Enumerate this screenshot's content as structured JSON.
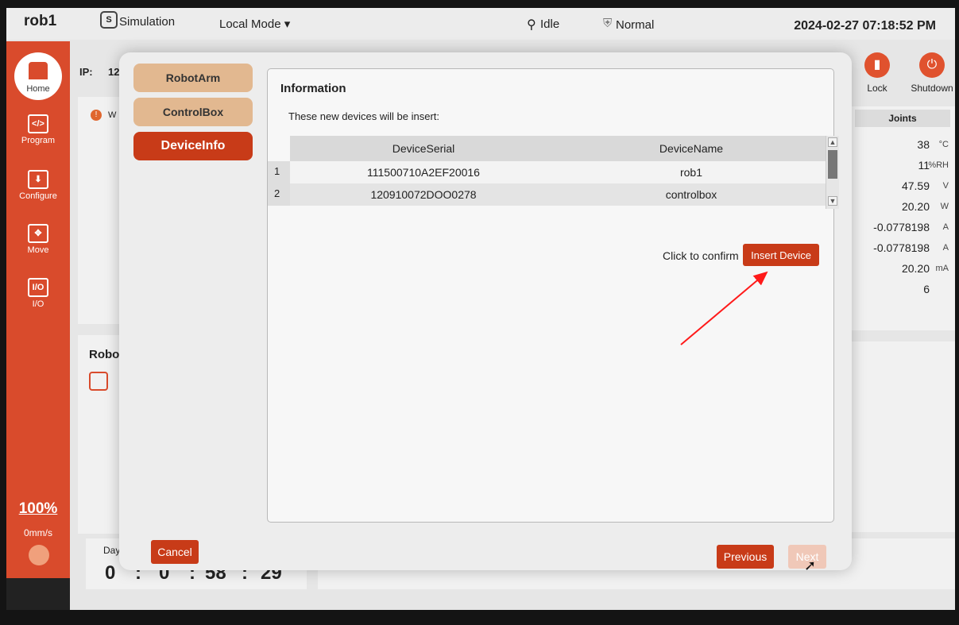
{
  "topbar": {
    "app_name": "rob1",
    "simulation_label": "Simulation",
    "sim_icon_glyph": "S",
    "mode_label": "Local Mode ▾",
    "status_label": "Idle",
    "safety_label": "Normal",
    "datetime": "2024-02-27 07:18:52 PM"
  },
  "sidebar": {
    "items": [
      {
        "label": "Home",
        "icon": "home-icon"
      },
      {
        "label": "Program",
        "icon": "code-icon",
        "glyph": "</>"
      },
      {
        "label": "Configure",
        "icon": "configure-icon",
        "glyph": "⬇"
      },
      {
        "label": "Move",
        "icon": "move-icon",
        "glyph": "✥"
      },
      {
        "label": "I/O",
        "icon": "io-icon",
        "glyph": "I/O"
      }
    ],
    "speed_percent": "100%",
    "speed_value": "0mm/s"
  },
  "background": {
    "ip_label": "IP:",
    "ip_partial": "12",
    "warning_partial": "W",
    "robot_partial": "Robo",
    "day_label": "Day",
    "timer": [
      "0",
      ":",
      "0",
      ":",
      "58",
      ":",
      "29"
    ],
    "lock_label": "Lock",
    "shutdown_label": "Shutdown",
    "joints_label": "Joints",
    "stats": [
      {
        "value": "38",
        "unit": "°C"
      },
      {
        "value": "11",
        "unit": "%RH"
      },
      {
        "value": "47.59",
        "unit": "V"
      },
      {
        "value": "20.20",
        "unit": "W"
      },
      {
        "value": "-0.0778198",
        "unit": "A"
      },
      {
        "value": "-0.0778198",
        "unit": "A"
      },
      {
        "value": "20.20",
        "unit": "mA"
      },
      {
        "value": "6",
        "unit": ""
      }
    ]
  },
  "modal": {
    "tabs": [
      "RobotArm",
      "ControlBox",
      "DeviceInfo"
    ],
    "active_tab": "DeviceInfo",
    "title": "Information",
    "subtitle": "These new devices will be insert:",
    "columns": [
      "DeviceSerial",
      "DeviceName"
    ],
    "rows": [
      {
        "num": "1",
        "serial": "111500710A2EF20016",
        "name": "rob1"
      },
      {
        "num": "2",
        "serial": "120910072DOO0278",
        "name": "controlbox"
      }
    ],
    "confirm_text": "Click to confirm",
    "insert_button": "Insert Device",
    "cancel_button": "Cancel",
    "previous_button": "Previous",
    "next_button": "Next"
  },
  "colors": {
    "accent": "#c83b18",
    "sidebar": "#d94b2c",
    "tab_inactive": "#e2b890"
  }
}
